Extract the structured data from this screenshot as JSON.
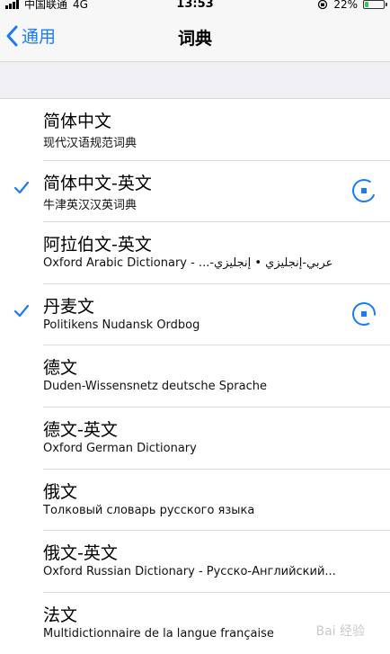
{
  "status_bar": {
    "carrier": "中国联通",
    "network": "4G",
    "time": "13:53",
    "battery": "22%",
    "battery_level": 0.22,
    "accent": "#35c759"
  },
  "nav": {
    "back_label": "通用",
    "title": "词典",
    "accent": "#1a7cf5"
  },
  "dictionaries": [
    {
      "title": "简体中文",
      "subtitle": "现代汉语规范词典",
      "checked": false,
      "downloading": false
    },
    {
      "title": "简体中文-英文",
      "subtitle": "牛津英汉汉英词典",
      "checked": true,
      "downloading": true
    },
    {
      "title": "阿拉伯文-英文",
      "subtitle": "Oxford Arabic Dictionary - ...-عربي-إنجليزي • إنجليزي",
      "checked": false,
      "downloading": false
    },
    {
      "title": "丹麦文",
      "subtitle": "Politikens Nudansk Ordbog",
      "checked": true,
      "downloading": true
    },
    {
      "title": "德文",
      "subtitle": "Duden-Wissensnetz deutsche Sprache",
      "checked": false,
      "downloading": false
    },
    {
      "title": "德文-英文",
      "subtitle": "Oxford German Dictionary",
      "checked": false,
      "downloading": false
    },
    {
      "title": "俄文",
      "subtitle": "Толковый словарь русского языка",
      "checked": false,
      "downloading": false
    },
    {
      "title": "俄文-英文",
      "subtitle": "Oxford Russian Dictionary - Русско-Английский...",
      "checked": false,
      "downloading": false
    },
    {
      "title": "法文",
      "subtitle": "Multidictionnaire de la langue française",
      "checked": false,
      "downloading": false
    }
  ],
  "watermark": "Bai 经验"
}
